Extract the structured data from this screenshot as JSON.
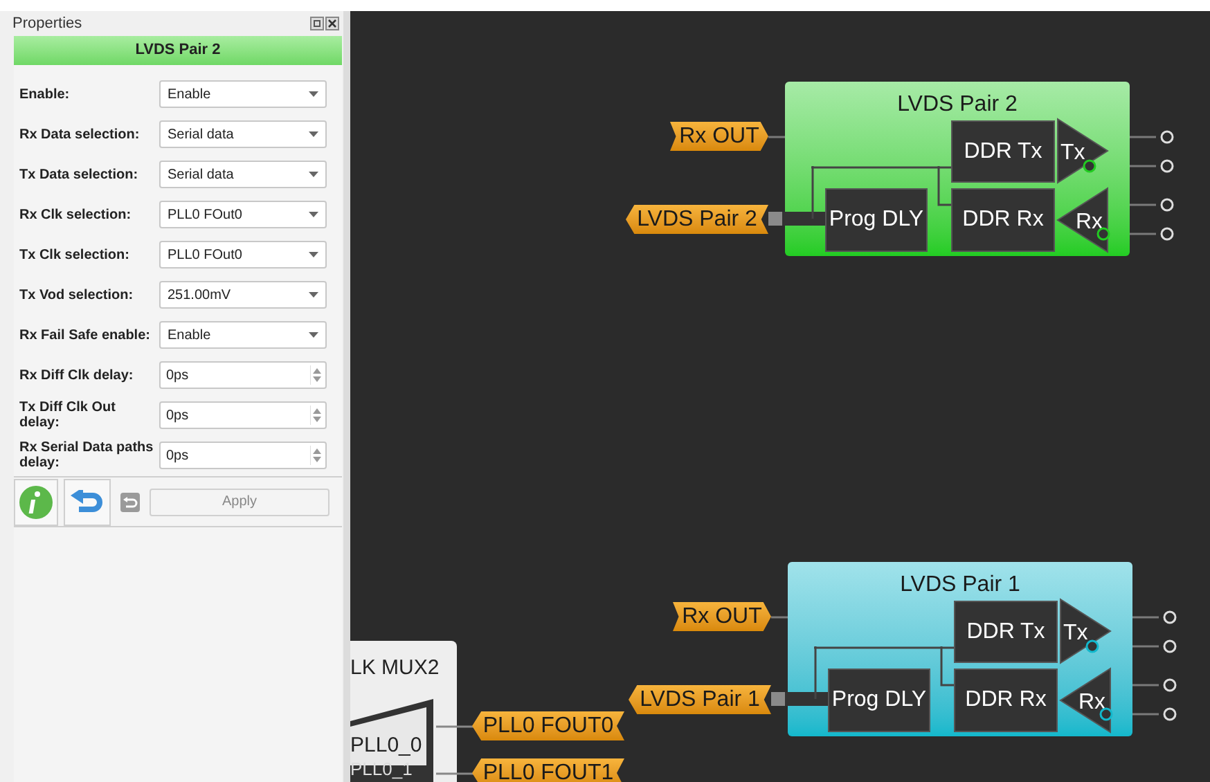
{
  "panel": {
    "title": "Properties",
    "header": "LVDS Pair 2",
    "fields": [
      {
        "label": "Enable:",
        "kind": "select",
        "value": "Enable"
      },
      {
        "label": "Rx Data selection:",
        "kind": "select",
        "value": "Serial data"
      },
      {
        "label": "Tx Data selection:",
        "kind": "select",
        "value": "Serial data"
      },
      {
        "label": "Rx Clk selection:",
        "kind": "select",
        "value": "PLL0 FOut0"
      },
      {
        "label": "Tx Clk selection:",
        "kind": "select",
        "value": "PLL0 FOut0"
      },
      {
        "label": "Tx Vod selection:",
        "kind": "select",
        "value": "251.00mV"
      },
      {
        "label": "Rx Fail Safe enable:",
        "kind": "select",
        "value": "Enable"
      },
      {
        "label": "Rx Diff Clk delay:",
        "kind": "spin",
        "value": "0ps"
      },
      {
        "label": "Tx Diff Clk Out delay:",
        "kind": "spin",
        "value": "0ps"
      },
      {
        "label": "Rx Serial Data paths delay:",
        "kind": "spin",
        "value": "0ps"
      }
    ],
    "apply": "Apply"
  },
  "blocks": [
    {
      "title": "LVDS Pair 2",
      "color": "#22cc22",
      "tx": "DDR Tx",
      "rx": "DDR Rx",
      "dly": "Prog DLY",
      "tx_driver": "Tx",
      "rx_driver": "Rx",
      "out_tag": "Rx OUT",
      "pair_tag": "LVDS Pair 2"
    },
    {
      "title": "LVDS Pair 1",
      "color": "#12b8cc",
      "tx": "DDR Tx",
      "rx": "DDR Rx",
      "dly": "Prog DLY",
      "tx_driver": "Tx",
      "rx_driver": "Rx",
      "out_tag": "Rx OUT",
      "pair_tag": "LVDS Pair 1"
    }
  ],
  "mux": {
    "title": "LK MUX2",
    "ports": [
      "PLL0_0",
      "PLL0_1"
    ],
    "tags": [
      "PLL0 FOUT0",
      "PLL0 FOUT1"
    ]
  }
}
